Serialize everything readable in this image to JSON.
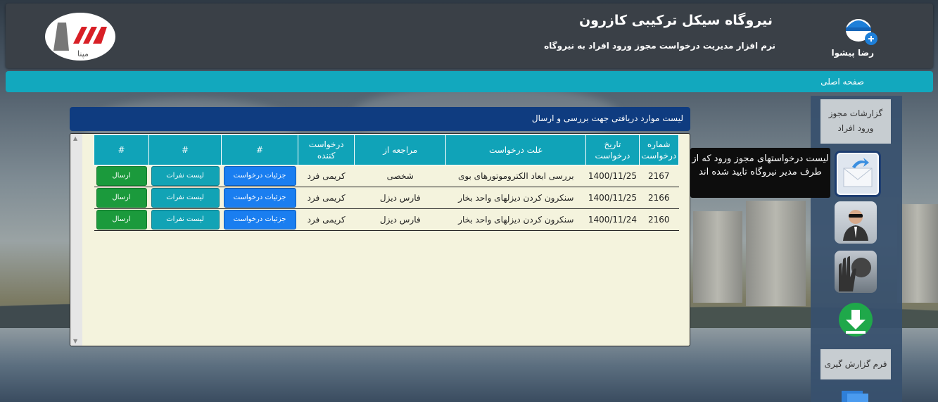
{
  "header": {
    "title": "نیروگاه سیکل ترکیبی کازرون",
    "subtitle": "نرم افزار مدیریت درخواست مجوز ورود افراد به نیروگاه",
    "user_name": "رضا پیشوا",
    "logo_text": "مپنا"
  },
  "nav": {
    "home": "صفحه اصلی"
  },
  "sidebar": {
    "reports_button": "گزارشات مجوز ورود افراد",
    "report_form_button": "فرم گزارش گیری",
    "icons": [
      "envelope-icon",
      "agent-icon",
      "stop-hand-icon",
      "download-icon",
      "documents-icon"
    ]
  },
  "tooltip": {
    "text": "لیست درخواستهای مجوز ورود که از طرف مدیر نیروگاه تایید شده اند"
  },
  "panel": {
    "title": "لیست موارد دریافتی جهت بررسی و ارسال",
    "columns": [
      "شماره درخواست",
      "تاریخ درخواست",
      "علت درخواست",
      "مراجعه از",
      "درخواست کننده",
      "#",
      "#",
      "#"
    ],
    "rows": [
      {
        "id": "2167",
        "date": "1400/11/25",
        "reason": "بررسی ابعاد الکتروموتورهای بوی",
        "from": "شخصی",
        "requester": "کریمی فرد",
        "details": "جزئیات درخواست",
        "people": "لیست نفرات",
        "send": "ارسال"
      },
      {
        "id": "2166",
        "date": "1400/11/25",
        "reason": "سنکرون کردن دیزلهای واحد بخار",
        "from": "فارس دیزل",
        "requester": "کریمی فرد",
        "details": "جزئیات درخواست",
        "people": "لیست نفرات",
        "send": "ارسال"
      },
      {
        "id": "2160",
        "date": "1400/11/24",
        "reason": "سنکرون کردن دیزلهای واحد بخار",
        "from": "فارس دیزل",
        "requester": "کریمی فرد",
        "details": "جزئیات درخواست",
        "people": "لیست نفرات",
        "send": "ارسال"
      }
    ]
  },
  "colors": {
    "header_bg": "#3a4047",
    "nav_bg": "#12a8be",
    "panel_head": "#0f3c80",
    "table_head": "#10a3b8",
    "details_btn": "#1a7ef0",
    "people_btn": "#12a3b5",
    "send_btn": "#1b9a3c"
  }
}
